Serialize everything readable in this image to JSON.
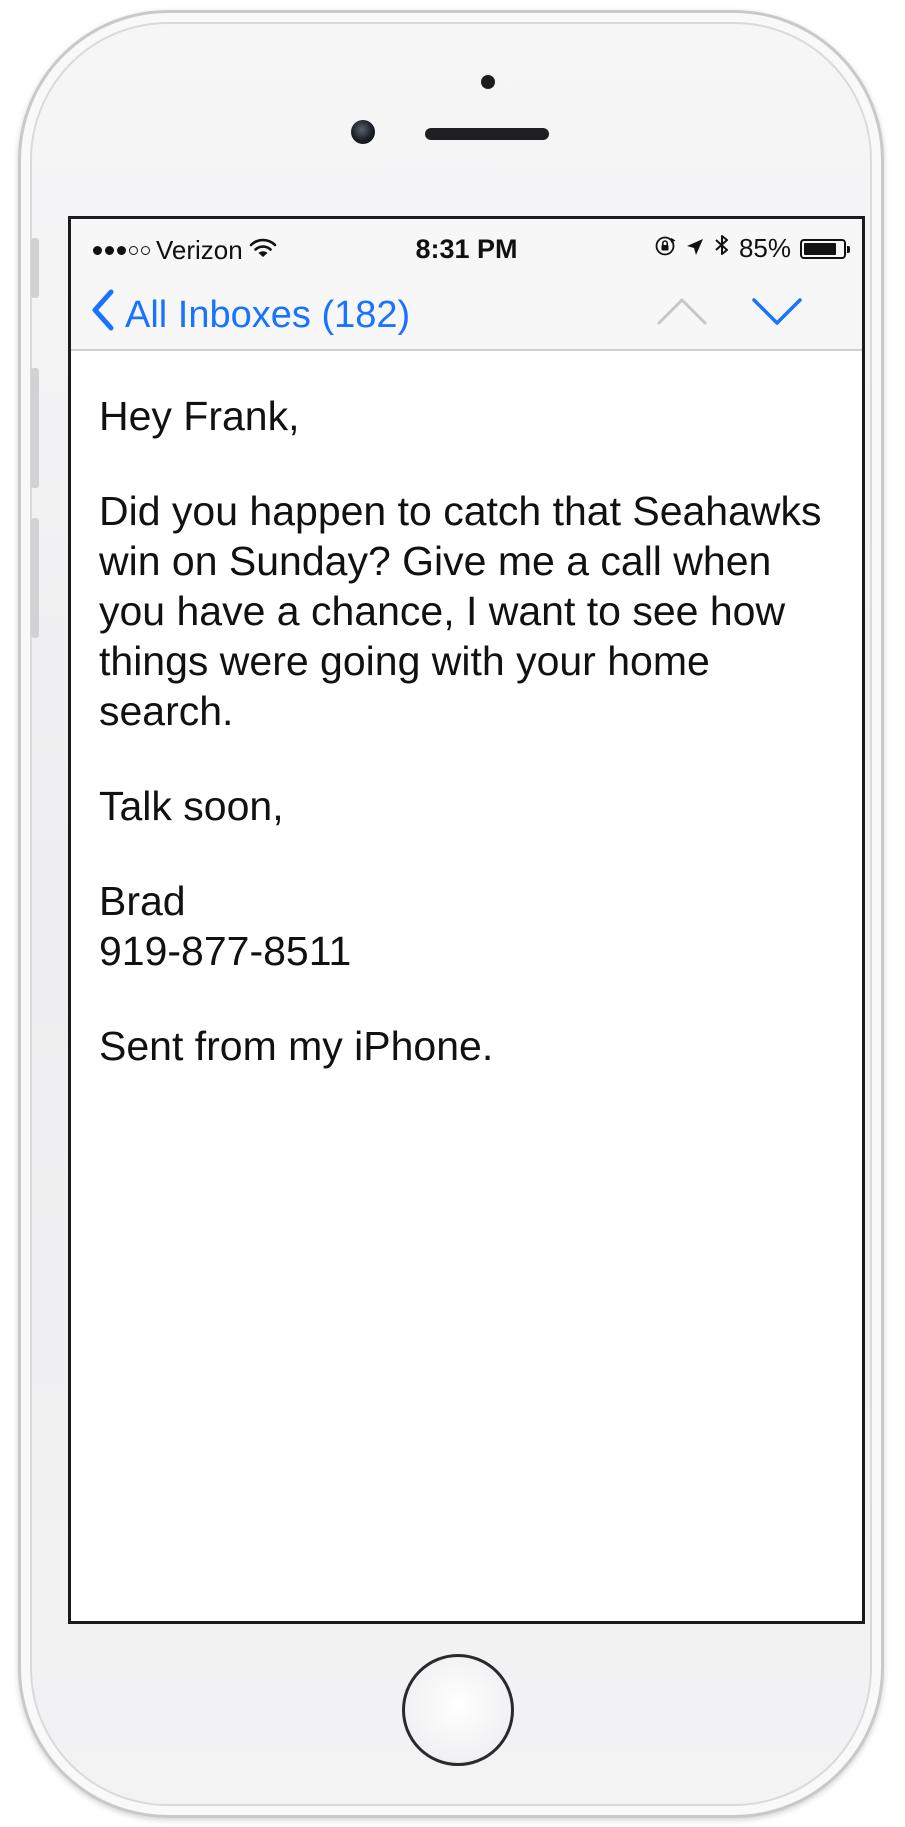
{
  "status_bar": {
    "carrier": "Verizon",
    "signal_bars_filled": 3,
    "signal_bars_total": 5,
    "time": "8:31 PM",
    "battery": "85%",
    "battery_level": 0.85,
    "icons": [
      "wifi-icon",
      "orientation-lock-icon",
      "location-arrow-icon",
      "bluetooth-icon",
      "battery-icon"
    ]
  },
  "nav": {
    "back_label": "All Inboxes (182)",
    "back_icon": "chevron-left-icon",
    "prev_icon": "chevron-up-icon",
    "next_icon": "chevron-down-icon",
    "accent": "#1a73ff",
    "disabled_color": "#c7c7cc"
  },
  "message": {
    "greeting": "Hey Frank,",
    "paragraph": "Did you happen to catch that Seahawks win on Sunday? Give me a call when you have a chance, I want to see how things were going with your home search.",
    "closing": "Talk soon,",
    "signature_name": "Brad",
    "signature_phone": "919-877-8511",
    "footer": "Sent from my iPhone."
  }
}
